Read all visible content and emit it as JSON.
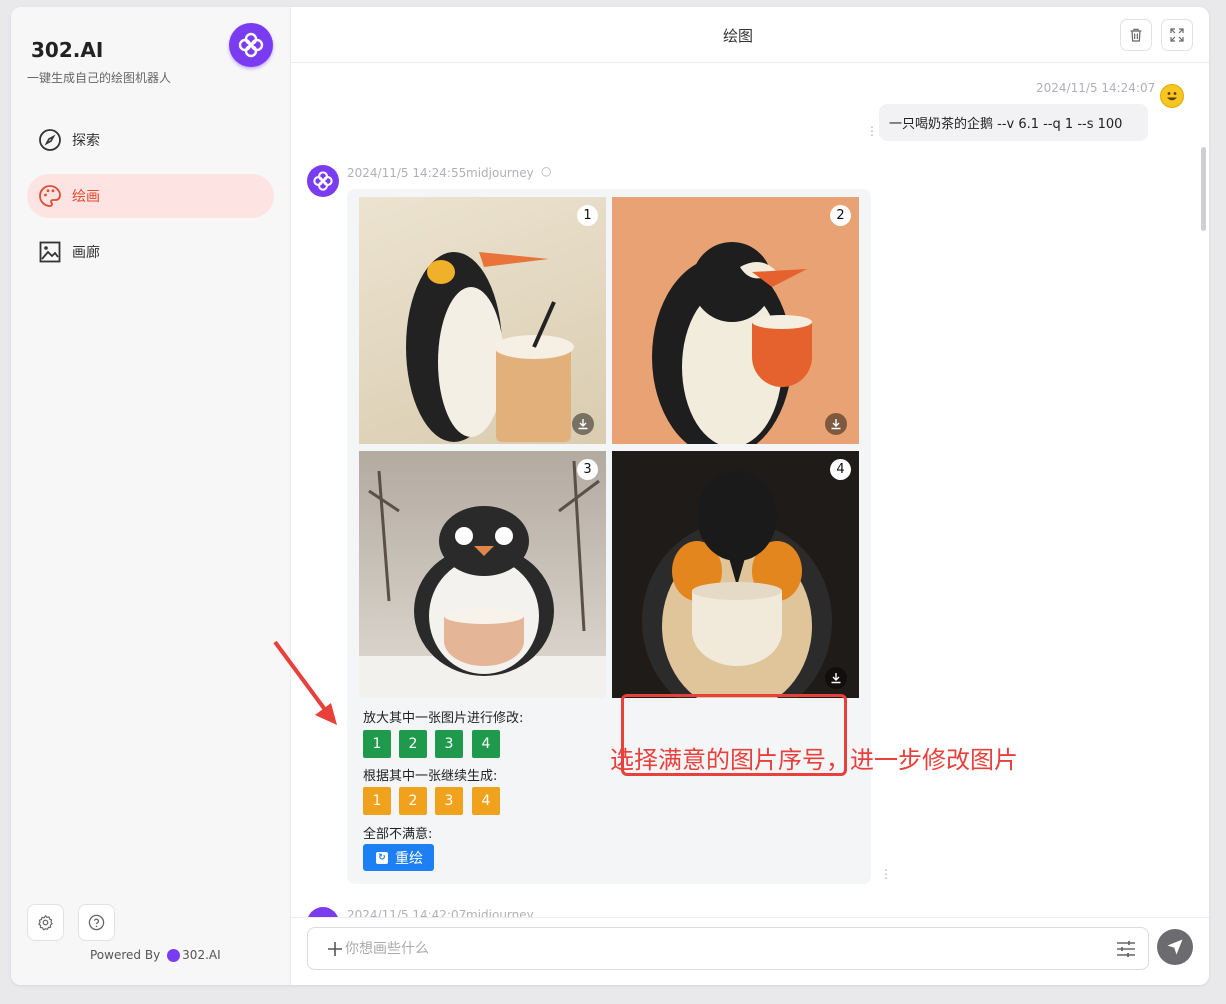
{
  "sidebar": {
    "brand_name": "302.AI",
    "brand_sub": "一键生成自己的绘图机器人",
    "items": [
      {
        "label": "探索",
        "icon": "compass-icon"
      },
      {
        "label": "绘画",
        "icon": "palette-icon",
        "active": true
      },
      {
        "label": "画廊",
        "icon": "image-icon"
      }
    ],
    "powered_prefix": "Powered By",
    "powered_brand": "302.AI"
  },
  "header": {
    "title": "绘图"
  },
  "chat": {
    "user_time": "2024/11/5 14:24:07",
    "user_message": "一只喝奶茶的企鹅 --v 6.1  --q 1  --s 100",
    "bot_time": "2024/11/5 14:24:55",
    "bot_model": "midjourney",
    "tiles": [
      "1",
      "2",
      "3",
      "4"
    ],
    "upscale_label": "放大其中一张图片进行修改:",
    "upscale_buttons": [
      "1",
      "2",
      "3",
      "4"
    ],
    "variation_label": "根据其中一张继续生成:",
    "variation_buttons": [
      "1",
      "2",
      "3",
      "4"
    ],
    "none_label": "全部不满意:",
    "redraw_label": "重绘",
    "next_time": "2024/11/5 14:42:07",
    "next_model": "midjourney"
  },
  "annotation": {
    "text": "选择满意的图片序号，进一步修改图片",
    "color": "#e8403a"
  },
  "input": {
    "placeholder": "你想画些什么"
  },
  "colors": {
    "accent": "#7a3cf0",
    "active_nav": "#e04a33",
    "upscale": "#1f9a4c",
    "variation": "#f0a21c",
    "redraw": "#1c7ff3"
  }
}
